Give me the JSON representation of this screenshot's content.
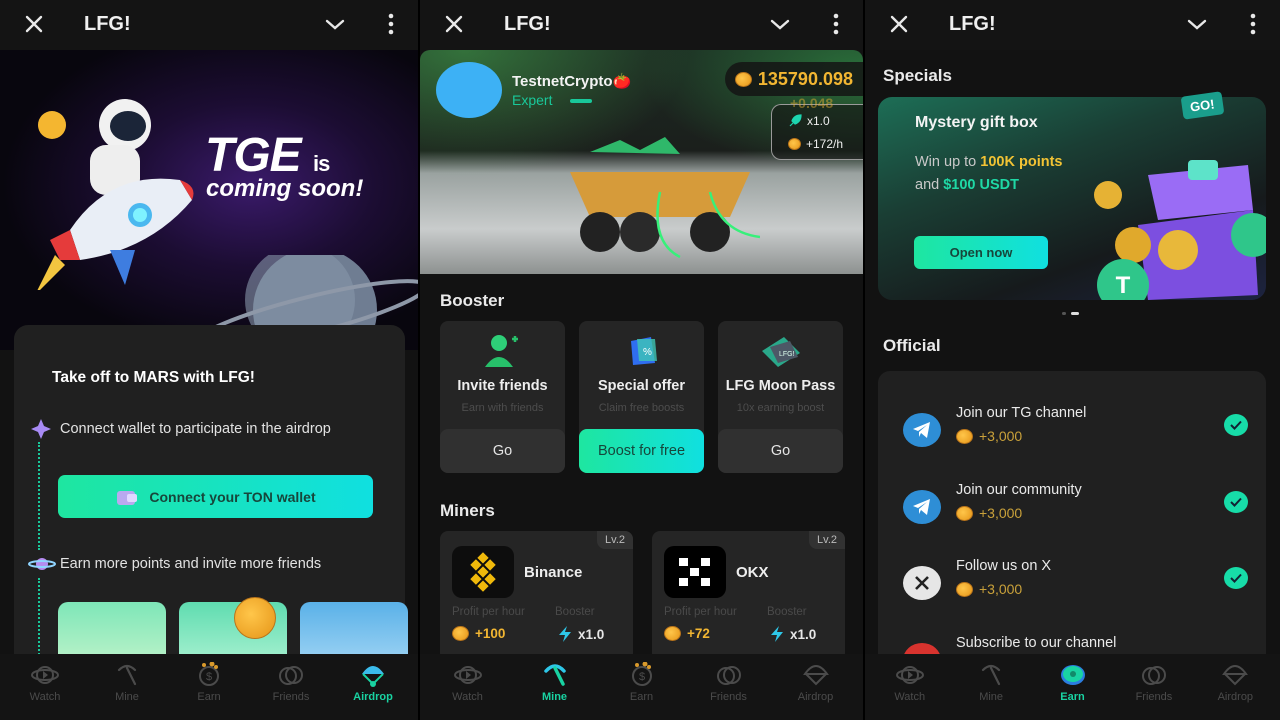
{
  "app": {
    "title": "LFG!"
  },
  "nav": {
    "items": [
      {
        "id": "watch",
        "label": "Watch"
      },
      {
        "id": "mine",
        "label": "Mine"
      },
      {
        "id": "earn",
        "label": "Earn"
      },
      {
        "id": "friends",
        "label": "Friends"
      },
      {
        "id": "airdrop",
        "label": "Airdrop"
      }
    ],
    "accent": "#19d3a2"
  },
  "airdrop_screen": {
    "active_tab": "Airdrop",
    "hero": {
      "headline": "TGE",
      "headline_suffix": "is",
      "subline": "coming soon!"
    },
    "card": {
      "title": "Take off to MARS with LFG!",
      "step1": "Connect wallet to participate in the airdrop",
      "connect_button": "Connect your TON wallet",
      "step2": "Earn more points and invite more friends"
    }
  },
  "mine_screen": {
    "active_tab": "Mine",
    "user": {
      "name": "TestnetCrypto🍅",
      "rank": "Expert"
    },
    "balance": "135790.098",
    "increment_ghost": "+0.048",
    "boost_multiplier": "x1.0",
    "rate": "+172/h",
    "booster_title": "Booster",
    "boosters": [
      {
        "title": "Invite friends",
        "subtitle": "Earn with friends",
        "button": "Go"
      },
      {
        "title": "Special offer",
        "subtitle": "Claim free boosts",
        "button": "Boost for free"
      },
      {
        "title": "LFG Moon Pass",
        "subtitle": "10x earning boost",
        "button": "Go"
      }
    ],
    "miners_title": "Miners",
    "miners": [
      {
        "name": "Binance",
        "level": "Lv.2",
        "profit_label": "Profit per hour",
        "profit": "+100",
        "booster_label": "Booster",
        "booster": "x1.0"
      },
      {
        "name": "OKX",
        "level": "Lv.2",
        "profit_label": "Profit per hour",
        "profit": "+72",
        "booster_label": "Booster",
        "booster": "x1.0"
      }
    ]
  },
  "earn_screen": {
    "active_tab": "Earn",
    "specials_title": "Specials",
    "special": {
      "title": "Mystery gift box",
      "line1_prefix": "Win up to ",
      "line1_highlight": "100K points",
      "line2_prefix": "and ",
      "line2_highlight": "$100 USDT",
      "button": "Open now",
      "badge": "GO!"
    },
    "carousel": {
      "count": 2,
      "active": 2
    },
    "official_title": "Official",
    "tasks": [
      {
        "name": "Join our TG channel",
        "reward": "+3,000",
        "icon": "telegram-icon",
        "done": true
      },
      {
        "name": "Join our community",
        "reward": "+3,000",
        "icon": "telegram-icon",
        "done": true
      },
      {
        "name": "Follow us on X",
        "reward": "+3,000",
        "icon": "x-icon",
        "done": true
      },
      {
        "name": "Subscribe to our channel",
        "reward": "",
        "icon": "youtube-icon",
        "done": false
      }
    ]
  }
}
